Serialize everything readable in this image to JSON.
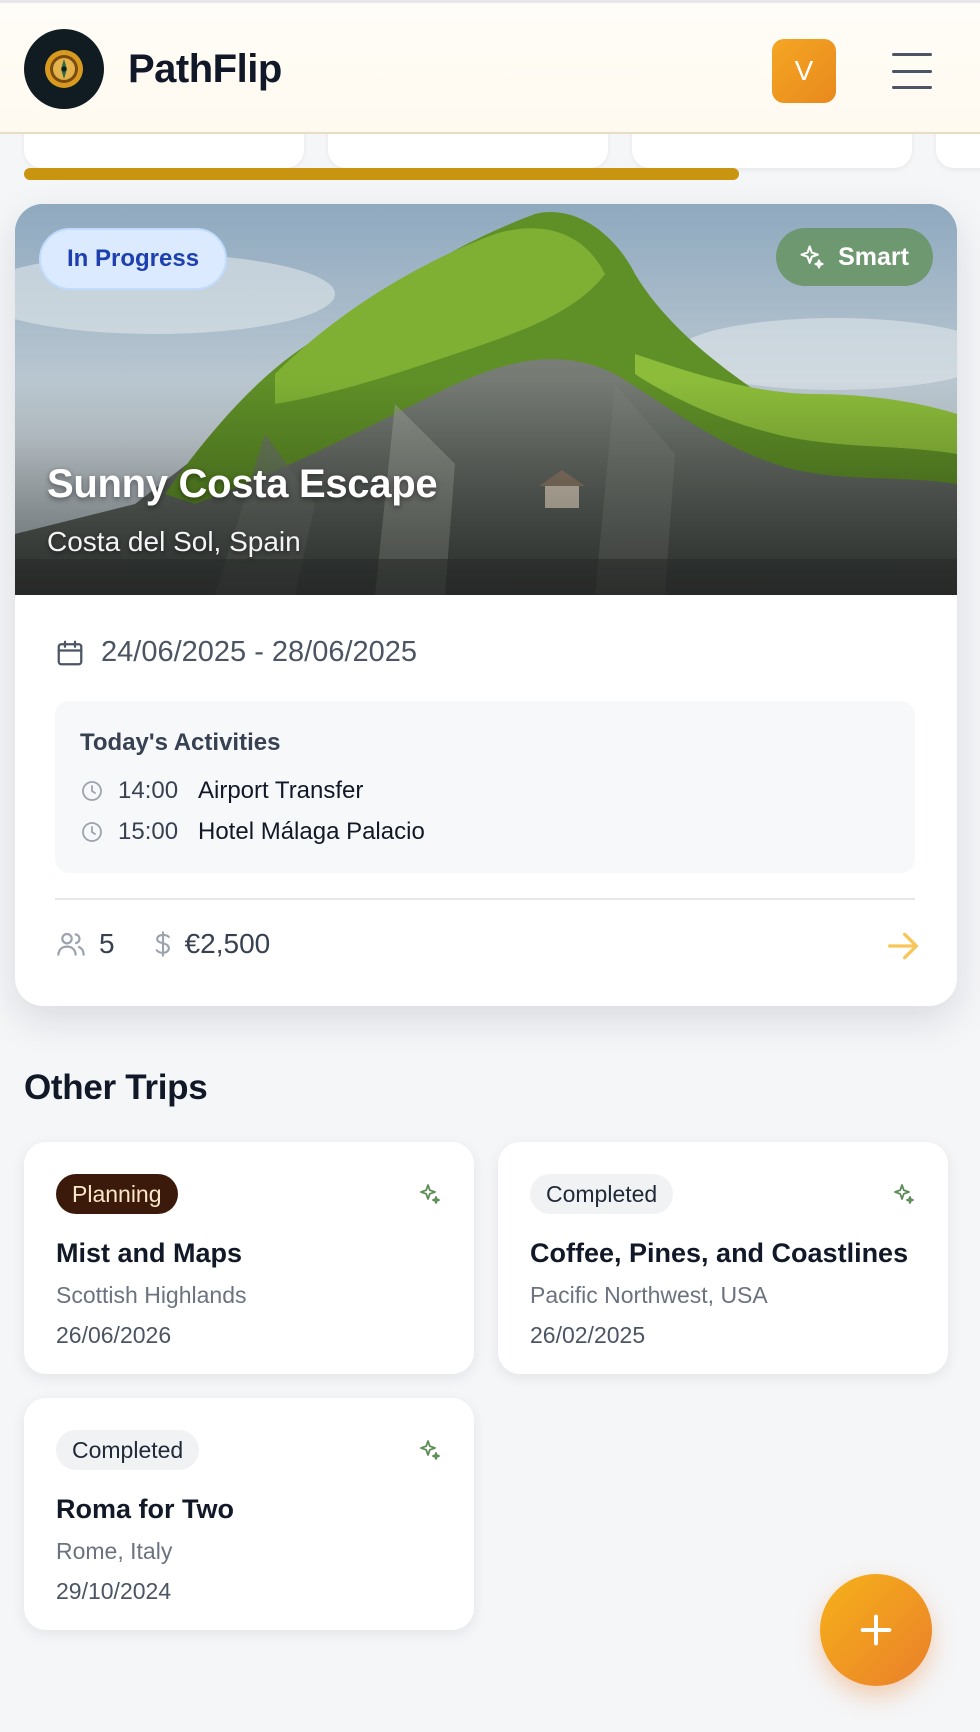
{
  "header": {
    "brand": "PathFlip",
    "avatar_initial": "V"
  },
  "carousel": {
    "progress": 0.73
  },
  "featured": {
    "status": "In Progress",
    "smart_label": "Smart",
    "title": "Sunny Costa Escape",
    "location": "Costa del Sol, Spain",
    "dates": "24/06/2025 - 28/06/2025",
    "today_title": "Today's Activities",
    "activities": [
      {
        "time": "14:00",
        "name": "Airport Transfer"
      },
      {
        "time": "15:00",
        "name": "Hotel Málaga Palacio"
      }
    ],
    "travelers": "5",
    "budget": "€2,500"
  },
  "other_trips": {
    "title": "Other Trips",
    "items": [
      {
        "status": "Planning",
        "name": "Mist and Maps",
        "location": "Scottish Highlands",
        "date": "26/06/2026"
      },
      {
        "status": "Completed",
        "name": "Coffee, Pines, and Coastlines",
        "location": "Pacific Northwest, USA",
        "date": "26/02/2025"
      },
      {
        "status": "Completed",
        "name": "Roma for Two",
        "location": "Rome, Italy",
        "date": "29/10/2024"
      }
    ]
  },
  "colors": {
    "accent": "#f5a623",
    "carousel_track": "#c99510",
    "smart_green": "#689464",
    "progress_badge_bg": "#dbeafe",
    "planning_bg": "#3b1a0c"
  },
  "icons": {
    "header": [
      "app-logo",
      "menu-icon"
    ],
    "featured": [
      "sparkles-icon",
      "calendar-icon",
      "clock-icon",
      "users-icon",
      "dollar-icon",
      "arrow-right-icon"
    ],
    "fab": "plus-icon"
  }
}
